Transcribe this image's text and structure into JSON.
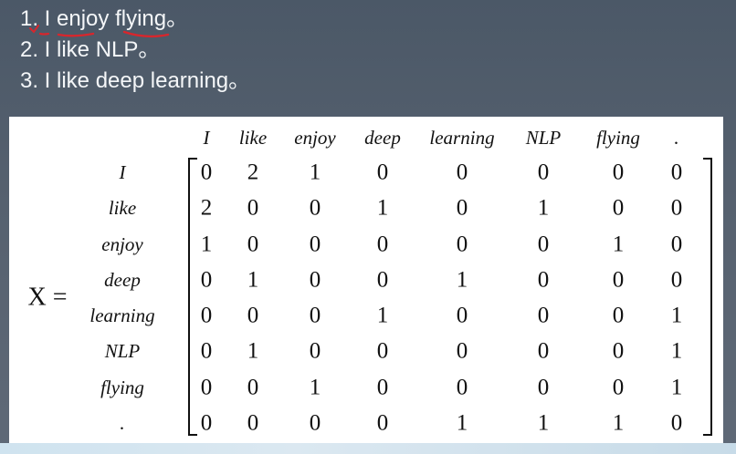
{
  "sentences": [
    "1. I enjoy flying。",
    "2. I like NLP。",
    "3. I like deep learning。"
  ],
  "matrix": {
    "label": "X =",
    "columns": [
      "I",
      "like",
      "enjoy",
      "deep",
      "learning",
      "NLP",
      "flying",
      "."
    ],
    "rows": [
      "I",
      "like",
      "enjoy",
      "deep",
      "learning",
      "NLP",
      "flying",
      "."
    ],
    "values": [
      [
        0,
        2,
        1,
        0,
        0,
        0,
        0,
        0
      ],
      [
        2,
        0,
        0,
        1,
        0,
        1,
        0,
        0
      ],
      [
        1,
        0,
        0,
        0,
        0,
        0,
        1,
        0
      ],
      [
        0,
        1,
        0,
        0,
        1,
        0,
        0,
        0
      ],
      [
        0,
        0,
        0,
        1,
        0,
        0,
        0,
        1
      ],
      [
        0,
        1,
        0,
        0,
        0,
        0,
        0,
        1
      ],
      [
        0,
        0,
        1,
        0,
        0,
        0,
        0,
        1
      ],
      [
        0,
        0,
        0,
        0,
        1,
        1,
        1,
        0
      ]
    ]
  },
  "colors": {
    "annotation": "#d8262c",
    "text_light": "#f4f6f8",
    "text_dark": "#111111"
  }
}
